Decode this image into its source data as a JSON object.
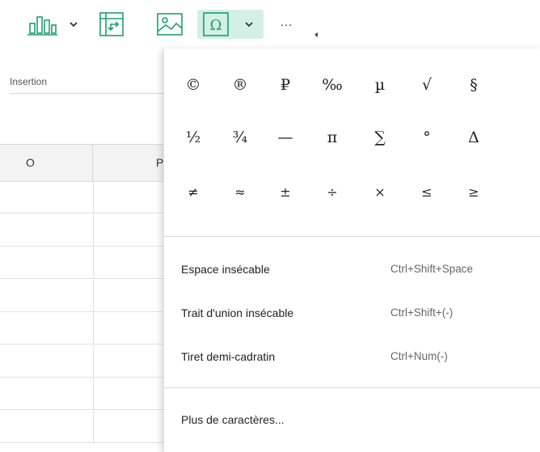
{
  "toolbar": {
    "items": [
      {
        "name": "chart-icon",
        "has_dropdown": true
      },
      {
        "name": "pivot-table-icon",
        "has_dropdown": false
      },
      {
        "name": "image-icon",
        "has_dropdown": false
      },
      {
        "name": "omega-symbol-icon",
        "has_dropdown": true,
        "active": true
      },
      {
        "name": "more-icon",
        "has_dropdown": false
      }
    ],
    "accent_color": "#1e9e6e",
    "active_bg": "#d3f0e6",
    "more_label": "···"
  },
  "ribbon": {
    "group_label": "Insertion"
  },
  "sheet": {
    "columns": [
      "O",
      "P"
    ]
  },
  "symbol_menu": {
    "rows": [
      [
        "©",
        "®",
        "₽",
        "‰",
        "µ",
        "√",
        "§"
      ],
      [
        "½",
        "¾",
        "—",
        "π",
        "∑",
        "°",
        "Δ"
      ],
      [
        "≠",
        "≈",
        "±",
        "÷",
        "×",
        "≤",
        "≥"
      ]
    ],
    "items": [
      {
        "label": "Espace insécable",
        "shortcut": "Ctrl+Shift+Space"
      },
      {
        "label": "Trait d'union insécable",
        "shortcut": "Ctrl+Shift+(-)"
      },
      {
        "label": "Tiret demi-cadratin",
        "shortcut": "Ctrl+Num(-)"
      }
    ],
    "more_label": "Plus de caractères..."
  }
}
